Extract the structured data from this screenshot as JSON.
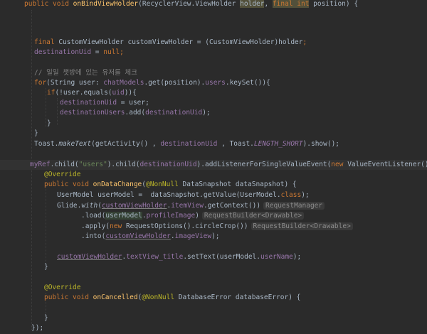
{
  "code": {
    "l1_a": "public void ",
    "l1_fn": "onBindViewHolder",
    "l1_b": "(RecyclerView.ViewHolder ",
    "l1_holder": "holder",
    "l1_c": ", ",
    "l1_final": "final int",
    "l1_d": " position) {",
    "l2_a": "final ",
    "l2_b": "CustomViewHolder customViewHolder = (CustomViewHolder)holder",
    "l2_c": ";",
    "l3_a": "destinationUid",
    "l3_b": " = ",
    "l3_c": "null",
    "l3_d": ";",
    "l4": "// 일일 챗방에 있는 유저를 체크",
    "l5_a": "for",
    "l5_b": "(String user: ",
    "l5_c": "chatModels",
    "l5_d": ".get(position).",
    "l5_e": "users",
    "l5_f": ".keySet()){",
    "l6_a": "if",
    "l6_b": "(!user.equals(",
    "l6_c": "uid",
    "l6_d": ")){",
    "l7_a": "destinationUid",
    "l7_b": " = user;",
    "l8_a": "destinationUsers",
    "l8_b": ".add(",
    "l8_c": "destinationUid",
    "l8_d": ");",
    "l9": "}",
    "l10": "}",
    "l11_a": "Toast.",
    "l11_b": "makeText",
    "l11_c": "(getActivity() , ",
    "l11_d": "destinationUid",
    "l11_e": " , Toast.",
    "l11_f": "LENGTH_SHORT",
    "l11_g": ").show();",
    "l12_a": "myRef",
    "l12_b": ".child(",
    "l12_c": "\"users\"",
    "l12_d": ").child(",
    "l12_e": "destinationUid",
    "l12_f": ").addListenerForSingleValueEvent(",
    "l12_g": "new ",
    "l12_h": "ValueEventListener() {",
    "l13": "@Override",
    "l14_a": "public void ",
    "l14_b": "onDataChange",
    "l14_c": "(",
    "l14_d": "@NonNull",
    "l14_e": " DataSnapshot dataSnapshot) {",
    "l15_a": "UserModel userModel =  dataSnapshot.getValue(UserModel.",
    "l15_b": "class",
    "l15_c": ");",
    "l16_a": "Glide.",
    "l16_b": "with",
    "l16_c": "(",
    "l16_d": "customViewHolder",
    "l16_e": ".",
    "l16_f": "itemView",
    "l16_g": ".getContext())",
    "l16_hint": "RequestManager",
    "l17_a": ".load(",
    "l17_b": "userModel",
    "l17_c": ".",
    "l17_d": "profileImage",
    "l17_e": ")",
    "l17_hint": "RequestBuilder<Drawable>",
    "l18_a": ".apply(",
    "l18_b": "new ",
    "l18_c": "RequestOptions().circleCrop())",
    "l18_hint": "RequestBuilder<Drawable>",
    "l19_a": ".into(",
    "l19_b": "customViewHolder",
    "l19_c": ".",
    "l19_d": "imageView",
    "l19_e": ");",
    "l20_a": "customViewHolder",
    "l20_b": ".",
    "l20_c": "textView_title",
    "l20_d": ".setText(userModel.",
    "l20_e": "userName",
    "l20_f": ");",
    "l21": "}",
    "l22": "@Override",
    "l23_a": "public void ",
    "l23_b": "onCancelled",
    "l23_c": "(",
    "l23_d": "@NonNull",
    "l23_e": " DatabaseError databaseError) {",
    "l24": "}",
    "l25": "});"
  },
  "colors": {
    "background": "#2b2b2b",
    "keyword": "#cc7832",
    "method": "#ffc66d",
    "field": "#9876aa",
    "string": "#6a8759",
    "comment": "#808080",
    "annotation": "#bbb529",
    "text": "#a9b7c6"
  }
}
